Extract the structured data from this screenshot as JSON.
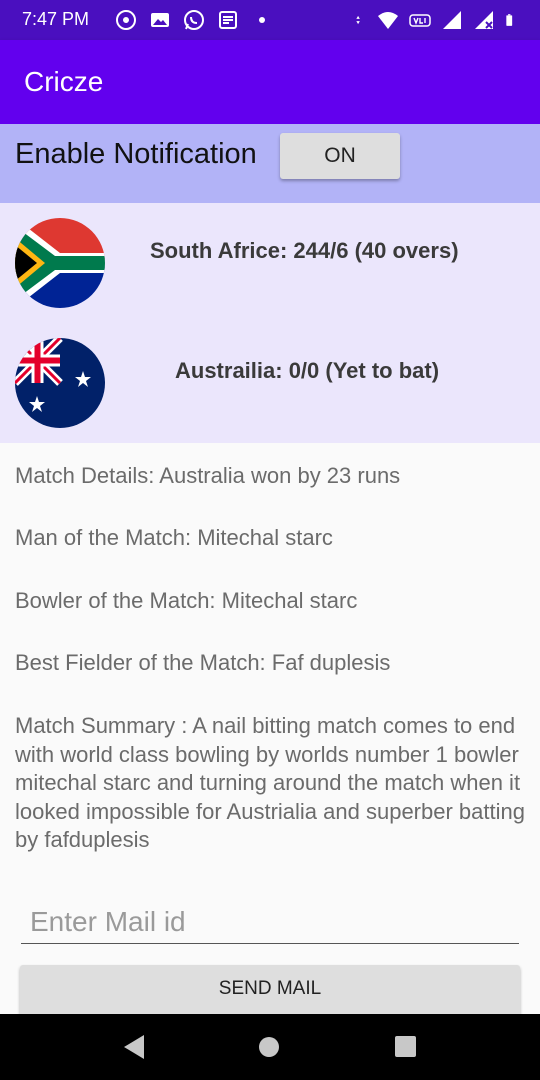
{
  "status_bar": {
    "time": "7:47 PM",
    "left_icons": [
      "music-icon",
      "gallery-icon",
      "whatsapp-icon",
      "news-icon",
      "dot-icon"
    ],
    "right_icons": [
      "data-arrows-icon",
      "wifi-icon",
      "volte-icon",
      "signal-icon",
      "signal-x-icon",
      "battery-icon"
    ]
  },
  "app_bar": {
    "title": "Cricze"
  },
  "notification": {
    "label": "Enable Notification",
    "toggle_label": "ON"
  },
  "teams": [
    {
      "flag": "south-africa-flag-icon",
      "score": "South Africe: 244/6 (40 overs)"
    },
    {
      "flag": "australia-flag-icon",
      "score": "Austrailia: 0/0 (Yet to bat)"
    }
  ],
  "details": {
    "match_details": "Match Details: Australia won by 23 runs",
    "man_of_match": "Man of the Match: Mitechal starc",
    "bowler_of_match": "Bowler of the Match: Mitechal starc",
    "best_fielder": "Best Fielder of the Match: Faf duplesis",
    "summary": "Match Summary : A nail bitting match comes to end with world class bowling by worlds number 1 bowler mitechal starc and turning around the match when it looked impossible for Austrialia and superber batting by fafduplesis"
  },
  "mail": {
    "placeholder": "Enter Mail id",
    "value": "",
    "send_label": "SEND MAIL"
  },
  "nav": [
    "back-icon",
    "home-icon",
    "recents-icon"
  ],
  "colors": {
    "status_bar": "#4a0fbf",
    "app_bar": "#6200ee",
    "notification_row": "#b2b3f7",
    "score_panel": "#ebe6fc",
    "button": "#dedede"
  }
}
